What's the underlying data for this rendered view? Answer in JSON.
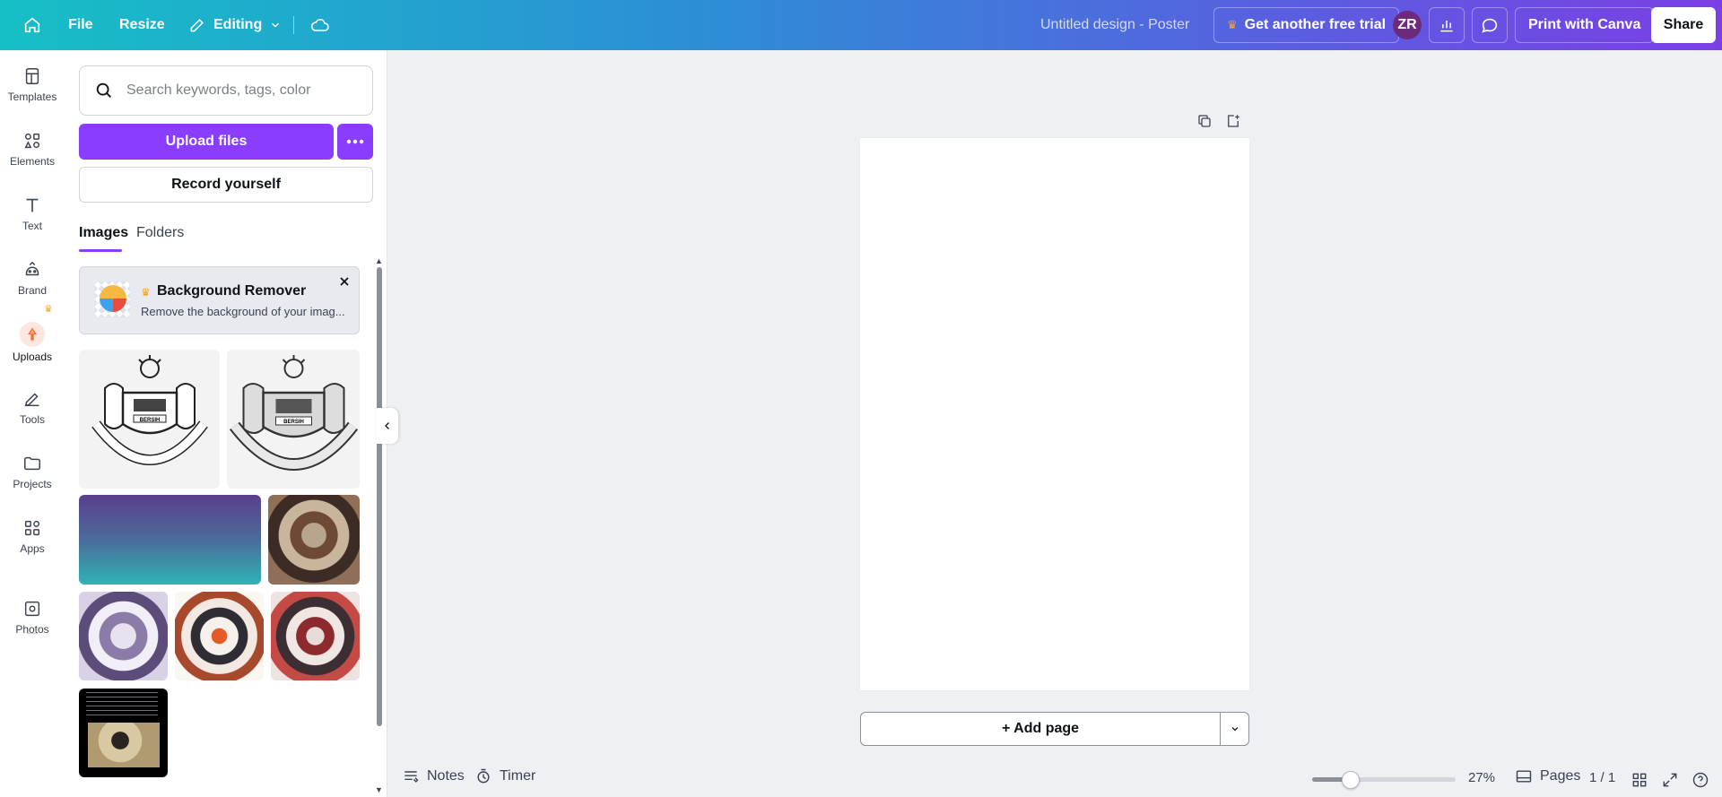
{
  "topbar": {
    "file_label": "File",
    "resize_label": "Resize",
    "editing_label": "Editing",
    "design_title": "Untitled design - Poster",
    "trial_label": "Get another free trial",
    "avatar_initials": "ZR",
    "print_label": "Print with Canva",
    "share_label": "Share",
    "gradient_colors": [
      "#16bfc6",
      "#2c8fd6",
      "#5a5ee0",
      "#7b3fe4"
    ]
  },
  "rail": {
    "items": [
      {
        "label": "Templates",
        "icon": "templates-icon"
      },
      {
        "label": "Elements",
        "icon": "elements-icon"
      },
      {
        "label": "Text",
        "icon": "text-icon"
      },
      {
        "label": "Brand",
        "icon": "brand-icon"
      },
      {
        "label": "Uploads",
        "icon": "uploads-icon"
      },
      {
        "label": "Tools",
        "icon": "tools-icon"
      },
      {
        "label": "Projects",
        "icon": "projects-icon"
      },
      {
        "label": "Apps",
        "icon": "apps-icon"
      },
      {
        "label": "Photos",
        "icon": "photos-icon"
      }
    ],
    "active": "Uploads"
  },
  "panel": {
    "search_placeholder": "Search keywords, tags, color",
    "upload_label": "Upload files",
    "record_label": "Record yourself",
    "tabs": [
      "Images",
      "Folders"
    ],
    "active_tab": "Images",
    "promo": {
      "title": "Background Remover",
      "description": "Remove the background of your imag..."
    },
    "uploads": [
      {
        "name": "emblem-logo-1",
        "emblem_text": "BERSIH"
      },
      {
        "name": "emblem-logo-2",
        "emblem_text": "BERSIH"
      },
      {
        "name": "gradient-image"
      },
      {
        "name": "rust-mask-image"
      },
      {
        "name": "purple-mask-image"
      },
      {
        "name": "orange-mask-image"
      },
      {
        "name": "red-mask-image"
      },
      {
        "name": "screenshot-image"
      }
    ],
    "accent_color": "#8b3dff"
  },
  "canvas": {
    "add_page_label": "+ Add page"
  },
  "bottombar": {
    "notes_label": "Notes",
    "timer_label": "Timer",
    "zoom_value": 0.27,
    "zoom_label": "27%",
    "pages_label": "Pages",
    "page_count": "1 / 1"
  }
}
